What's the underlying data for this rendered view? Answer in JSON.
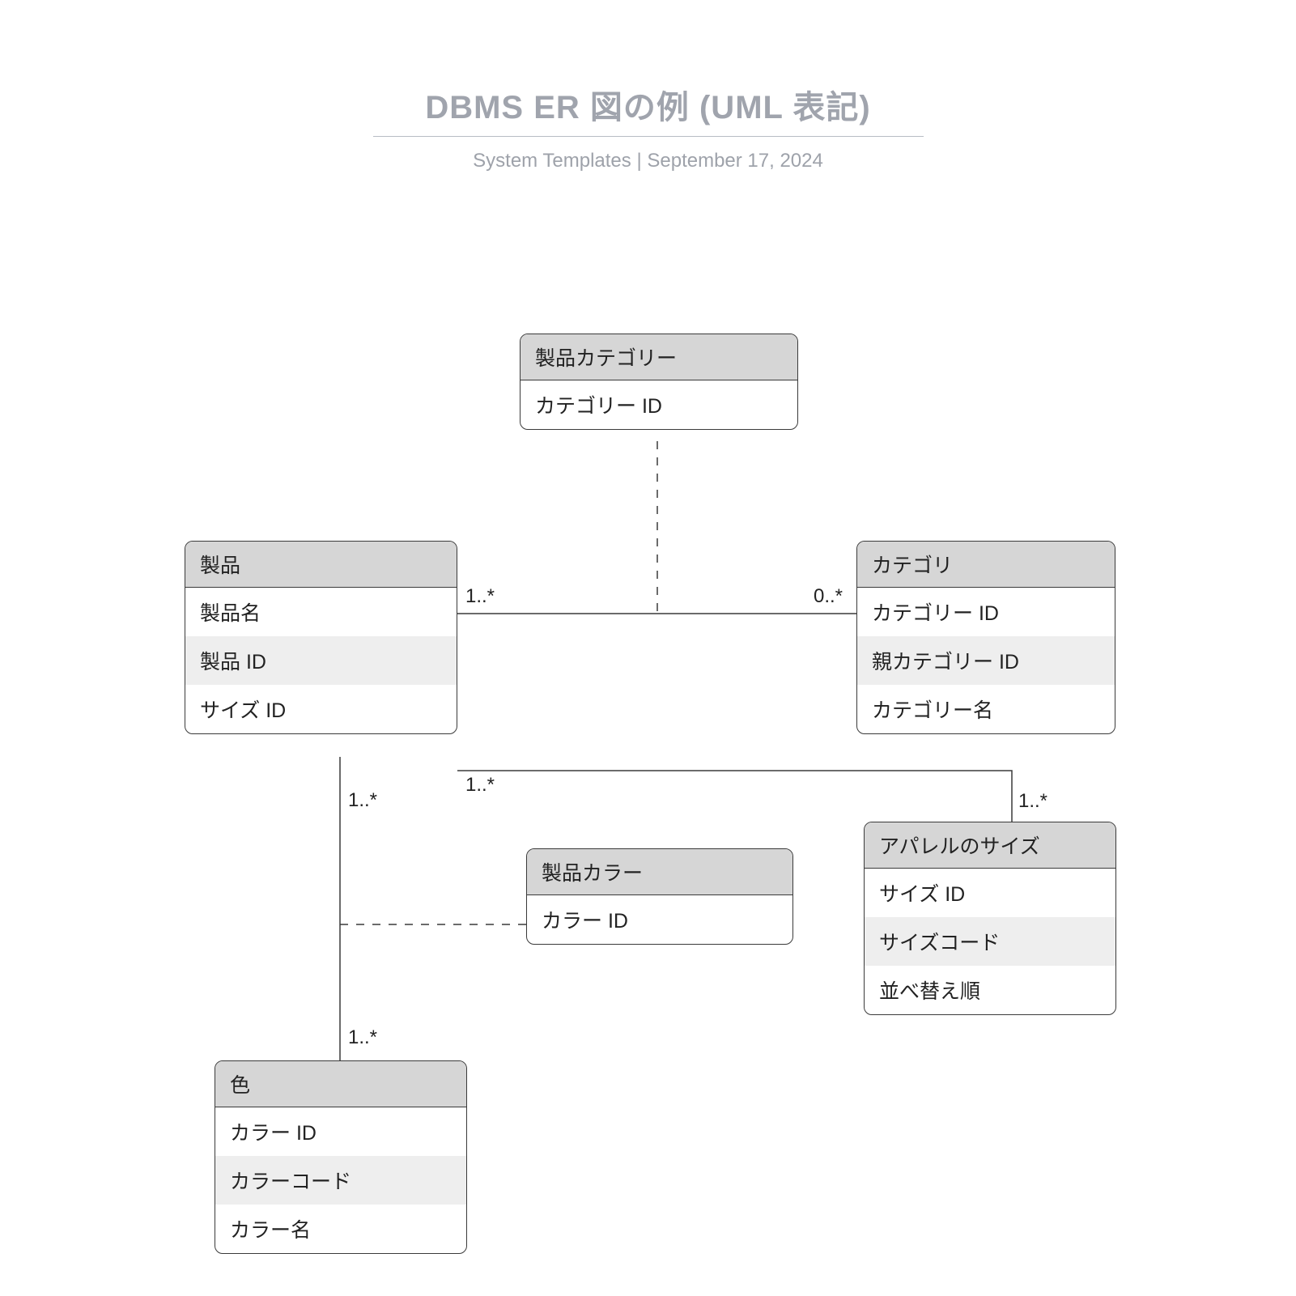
{
  "header": {
    "title": "DBMS ER 図の例 (UML 表記)",
    "subtitle_author": "System Templates",
    "subtitle_sep": "  |  ",
    "subtitle_date": "September 17, 2024"
  },
  "entities": {
    "product_category": {
      "title": "製品カテゴリー",
      "rows": [
        "カテゴリー ID"
      ]
    },
    "product": {
      "title": "製品",
      "rows": [
        "製品名",
        "製品 ID",
        "サイズ ID"
      ]
    },
    "category": {
      "title": "カテゴリ",
      "rows": [
        "カテゴリー ID",
        "親カテゴリー ID",
        "カテゴリー名"
      ]
    },
    "product_color": {
      "title": "製品カラー",
      "rows": [
        "カラー ID"
      ]
    },
    "apparel_size": {
      "title": "アパレルのサイズ",
      "rows": [
        "サイズ ID",
        "サイズコード",
        "並べ替え順"
      ]
    },
    "color": {
      "title": "色",
      "rows": [
        "カラー ID",
        "カラーコード",
        "カラー名"
      ]
    }
  },
  "multiplicities": {
    "product_side_top": "1..*",
    "category_side_top": "0..*",
    "product_side_mid": "1..*",
    "apparel_side": "1..*",
    "product_down_top": "1..*",
    "product_down_bottom": "1..*"
  }
}
